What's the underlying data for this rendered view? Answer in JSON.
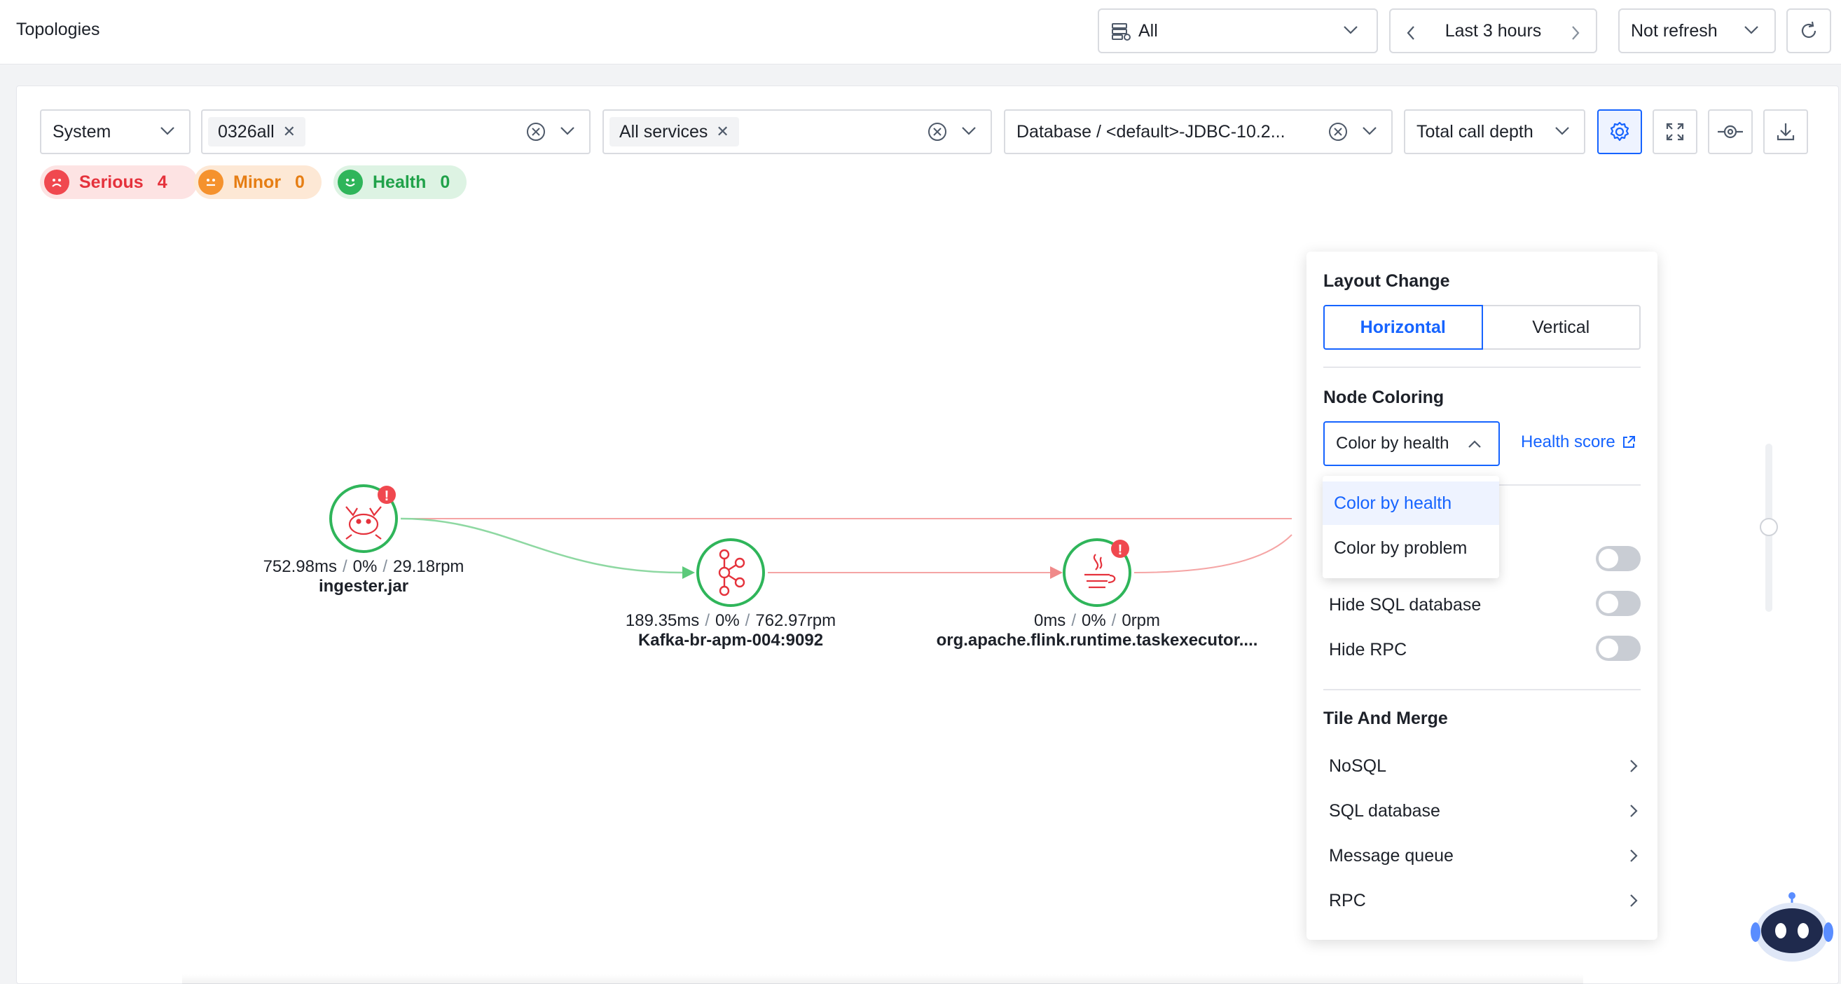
{
  "header": {
    "title": "Topologies",
    "env_select": "All",
    "time_range": "Last 3 hours",
    "refresh": "Not refresh"
  },
  "filters": {
    "system": "System",
    "tag1": "0326all",
    "tag2": "All services",
    "database": "Database / <default>-JDBC-10.2...",
    "depth": "Total call depth"
  },
  "health_badges": [
    {
      "label": "Serious",
      "count": "4",
      "color": "#e5323c"
    },
    {
      "label": "Minor",
      "count": "0",
      "color": "#e67e14"
    },
    {
      "label": "Health",
      "count": "0",
      "color": "#21a24a"
    }
  ],
  "graph": {
    "nodes": [
      {
        "name": "ingester.jar",
        "latency": "752.98ms",
        "error": "0%",
        "rpm": "29.18rpm",
        "icon": "tomcat-icon",
        "alert": true
      },
      {
        "name": "Kafka-br-apm-004:9092",
        "latency": "189.35ms",
        "error": "0%",
        "rpm": "762.97rpm",
        "icon": "kafka-icon",
        "alert": false
      },
      {
        "name": "org.apache.flink.runtime.taskexecutor....",
        "latency": "0ms",
        "error": "0%",
        "rpm": "0rpm",
        "icon": "java-icon",
        "alert": true
      }
    ],
    "edge_colors": {
      "healthy": "#5cc97a",
      "problem": "#f08a8a"
    }
  },
  "settings": {
    "layout_title": "Layout Change",
    "layout_options": [
      "Horizontal",
      "Vertical"
    ],
    "layout_selected": "Horizontal",
    "coloring_title": "Node Coloring",
    "coloring_selected": "Color by health",
    "health_score_link": "Health score",
    "toggles": [
      {
        "label": "Hide SQL database",
        "on": false
      },
      {
        "label": "Hide RPC",
        "on": false
      }
    ],
    "merge_title": "Tile And Merge",
    "merge_items": [
      "NoSQL",
      "SQL database",
      "Message queue",
      "RPC"
    ]
  },
  "coloring_dropdown": {
    "options": [
      "Color by health",
      "Color by problem"
    ],
    "selected": "Color by health"
  },
  "colors": {
    "accent": "#1664ff",
    "healthy_ring": "#2fb55a",
    "alert": "#f0484f"
  }
}
